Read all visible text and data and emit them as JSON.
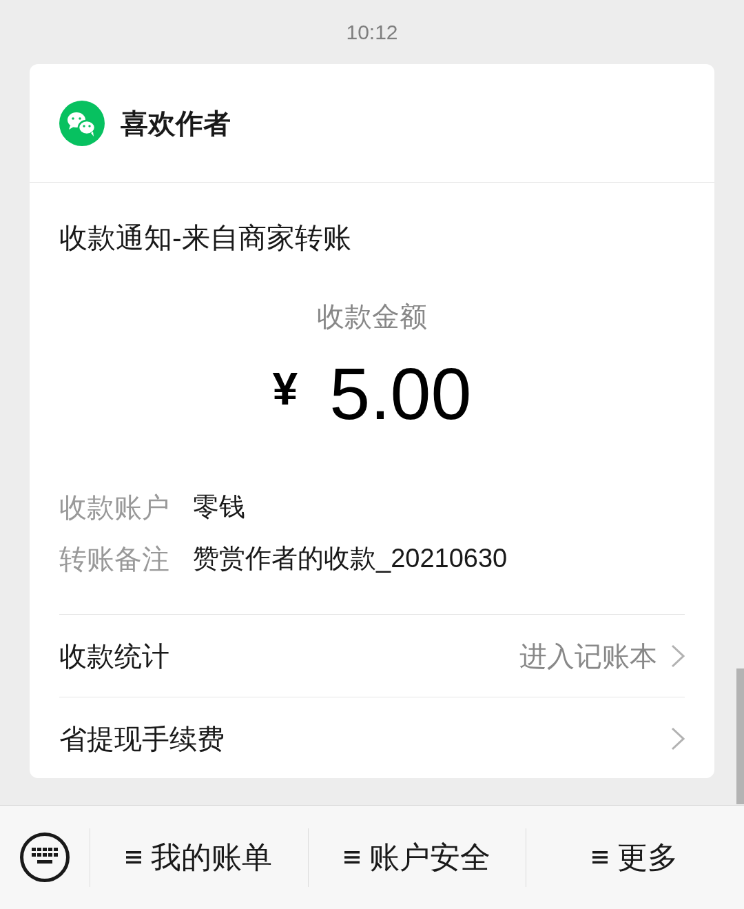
{
  "timestamp": "10:12",
  "card": {
    "sender": {
      "name": "喜欢作者"
    },
    "title": "收款通知-来自商家转账",
    "amount_label": "收款金额",
    "currency": "¥",
    "amount": "5.00",
    "details": [
      {
        "label": "收款账户",
        "value": "零钱"
      },
      {
        "label": "转账备注",
        "value": "赞赏作者的收款_20210630"
      }
    ],
    "links": [
      {
        "label": "收款统计",
        "action": "进入记账本"
      },
      {
        "label": "省提现手续费"
      }
    ]
  },
  "bottom_menu": [
    {
      "label": "我的账单"
    },
    {
      "label": "账户安全"
    },
    {
      "label": "更多"
    }
  ]
}
